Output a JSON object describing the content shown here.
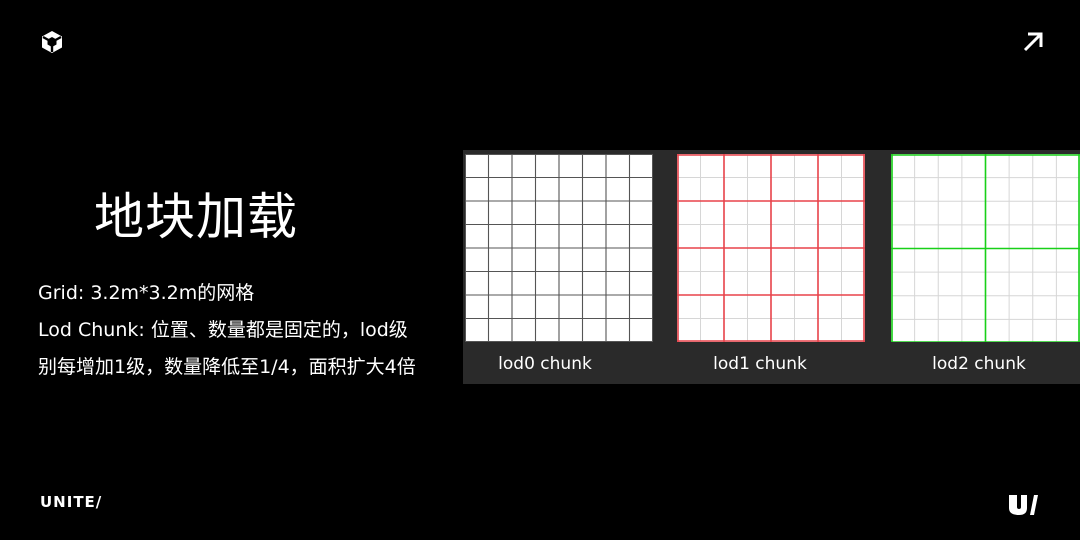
{
  "header": {
    "logo_icon": "unity-cube-icon",
    "external_link_icon": "arrow-up-right-icon"
  },
  "slide": {
    "title": "地块加载",
    "lines": [
      "Grid: 3.2m*3.2m的网格",
      "Lod Chunk: 位置、数量都是固定的，lod级",
      "别每增加1级，数量降低至1/4，面积扩大4倍"
    ]
  },
  "diagram": {
    "fine_grid_cells": 8,
    "chunks": [
      {
        "label": "lod0 chunk",
        "chunk_cells": 8,
        "highlight_color": ""
      },
      {
        "label": "lod1 chunk",
        "chunk_cells": 4,
        "highlight_color": "#e8424a"
      },
      {
        "label": "lod2 chunk",
        "chunk_cells": 2,
        "highlight_color": "#18d018"
      }
    ]
  },
  "footer": {
    "brand_text": "UNITE/",
    "brand_mark_icon": "unite-mark-icon"
  }
}
